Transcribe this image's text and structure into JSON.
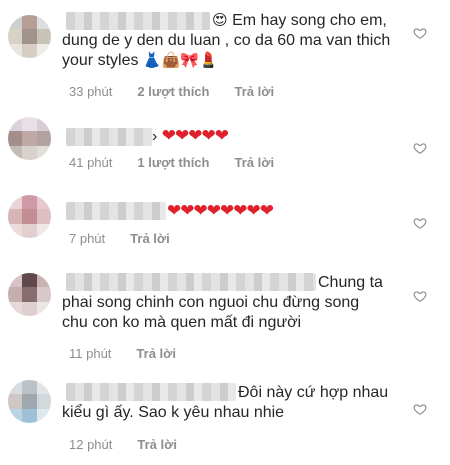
{
  "comments": [
    {
      "text": "Em hay song cho em, dung de y den du luan , co da 60 ma van thich your styles",
      "lead_emoji": "😍",
      "trail_emoji": "👗👜🎀💄",
      "time": "33 phút",
      "likes": "2 lượt thích",
      "reply": "Trả lời"
    },
    {
      "text": "",
      "hearts": "❤❤❤❤❤",
      "time": "41 phút",
      "likes": "1 lượt thích",
      "reply": "Trả lời"
    },
    {
      "text": "",
      "hearts": "❤❤❤❤❤❤❤❤",
      "time": "7 phút",
      "reply": "Trả lời"
    },
    {
      "text_line1": "Chung ta",
      "text_line2": "phai song chinh con nguoi chu đừng song",
      "text_line3": "chu con ko mà quen mất đi người",
      "time": "11 phút",
      "reply": "Trả lời"
    },
    {
      "text_line1": "Đôi này cứ hợp nhau",
      "text_line2": "kiểu gì ấy. Sao k yêu nhau nhie",
      "time": "12 phút",
      "reply": "Trả lời"
    }
  ],
  "icons": {
    "like": "heart-outline-icon"
  },
  "colors": {
    "text": "#262626",
    "meta": "#8e8e8e",
    "heart": "#e0212b"
  }
}
